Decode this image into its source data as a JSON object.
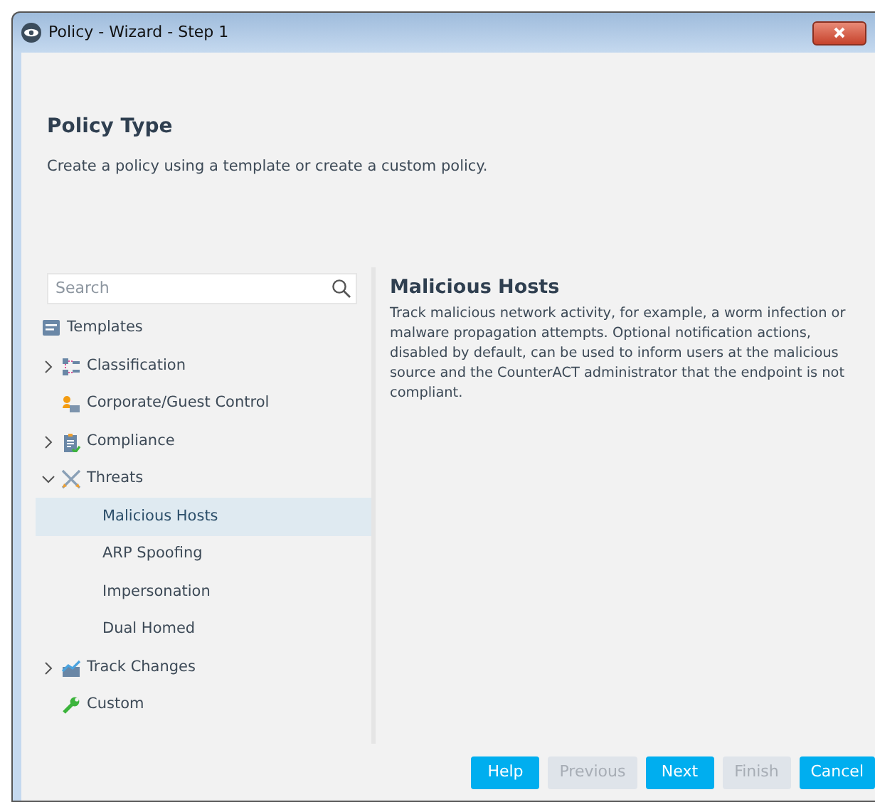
{
  "window": {
    "title": "Policy - Wizard - Step 1"
  },
  "header": {
    "title": "Policy Type",
    "subtitle": "Create a policy using a template or create a custom policy."
  },
  "search": {
    "placeholder": "Search"
  },
  "tree": [
    {
      "label": "Templates",
      "kind": "item"
    },
    {
      "label": "Classification",
      "kind": "folder",
      "expanded": false
    },
    {
      "label": "Corporate/Guest Control",
      "kind": "item"
    },
    {
      "label": "Compliance",
      "kind": "folder",
      "expanded": false
    },
    {
      "label": "Threats",
      "kind": "folder",
      "expanded": true,
      "children": [
        {
          "label": "Malicious Hosts",
          "selected": true
        },
        {
          "label": "ARP Spoofing",
          "selected": false
        },
        {
          "label": "Impersonation",
          "selected": false
        },
        {
          "label": "Dual Homed",
          "selected": false
        }
      ]
    },
    {
      "label": "Track Changes",
      "kind": "folder",
      "expanded": false
    },
    {
      "label": "Custom",
      "kind": "item"
    }
  ],
  "detail": {
    "title": "Malicious Hosts",
    "text": "Track malicious network activity, for example, a worm infection or malware propagation attempts. Optional notification actions, disabled by default, can be used to inform users at the malicious source and the CounterACT administrator that the endpoint is not compliant."
  },
  "buttons": [
    {
      "label": "Help",
      "disabled": false
    },
    {
      "label": "Previous",
      "disabled": true
    },
    {
      "label": "Next",
      "disabled": false
    },
    {
      "label": "Finish",
      "disabled": true
    },
    {
      "label": "Cancel",
      "disabled": false
    }
  ]
}
